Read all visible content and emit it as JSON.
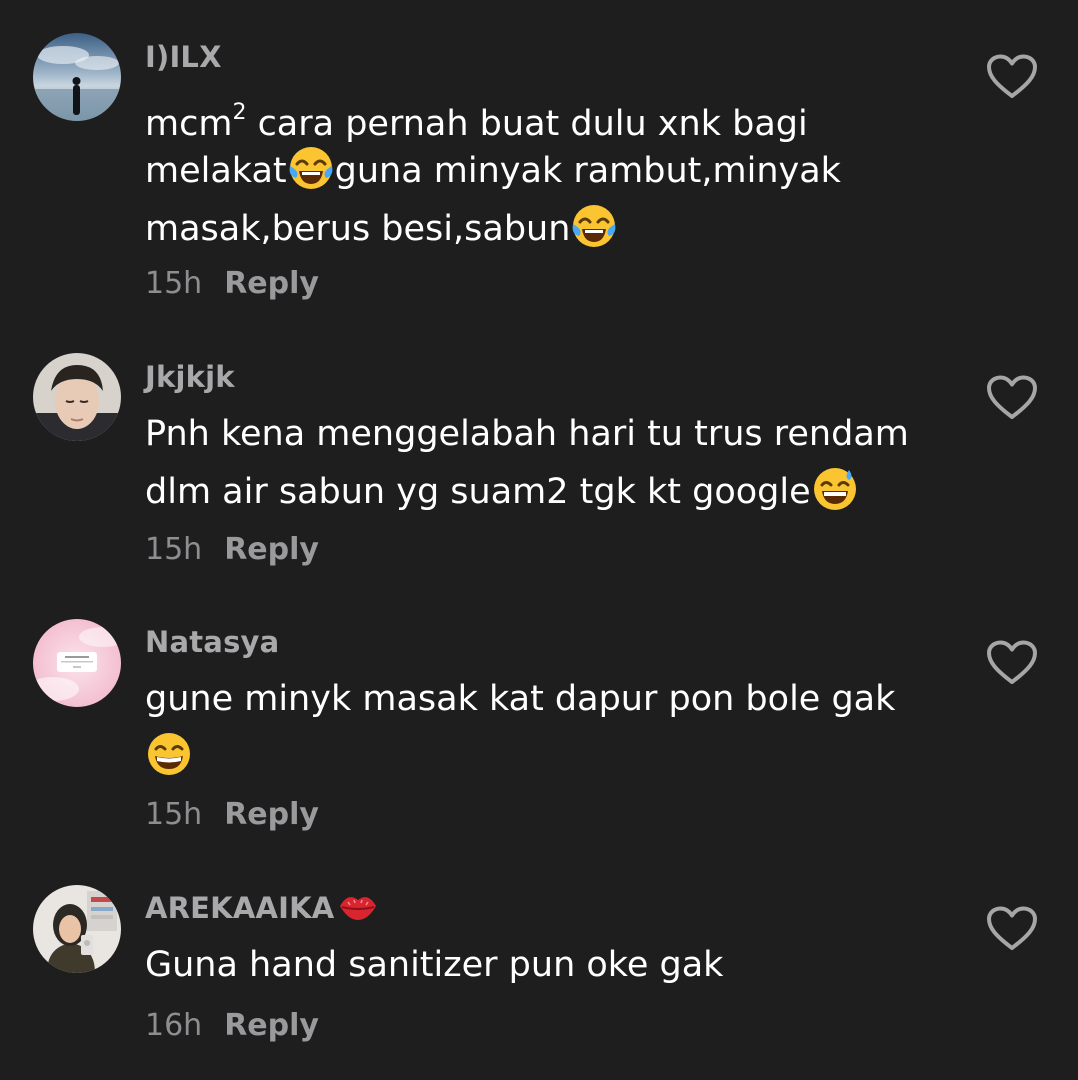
{
  "comments": [
    {
      "username": "I)ILX",
      "lines": [
        "mcm",
        "2",
        " cara pernah buat dulu xnk bagi",
        "melakat",
        "guna minyak rambut,minyak",
        "masak,berus besi,sabun"
      ],
      "time": "15h",
      "reply": "Reply",
      "emojis": [
        "face-with-tears-of-joy-icon",
        "face-with-tears-of-joy-icon"
      ]
    },
    {
      "username": "Jkjkjk",
      "lines": [
        "Pnh kena menggelabah hari tu trus rendam",
        "dlm air sabun yg suam2 tgk kt google"
      ],
      "time": "15h",
      "reply": "Reply",
      "emojis": [
        "grinning-face-with-sweat-icon"
      ]
    },
    {
      "username": "Natasya",
      "lines": [
        "gune minyk masak kat dapur pon bole gak"
      ],
      "time": "15h",
      "reply": "Reply",
      "emojis": [
        "beaming-face-icon"
      ]
    },
    {
      "username": "AREKAAIKA",
      "lines": [
        "Guna hand sanitizer pun oke gak"
      ],
      "time": "16h",
      "reply": "Reply",
      "emojis": [
        "kiss-mark-icon"
      ]
    }
  ],
  "colors": {
    "background": "#1e1e1f",
    "username": "#a9a9ab",
    "meta": "#8e8e91",
    "text": "#ffffff"
  }
}
